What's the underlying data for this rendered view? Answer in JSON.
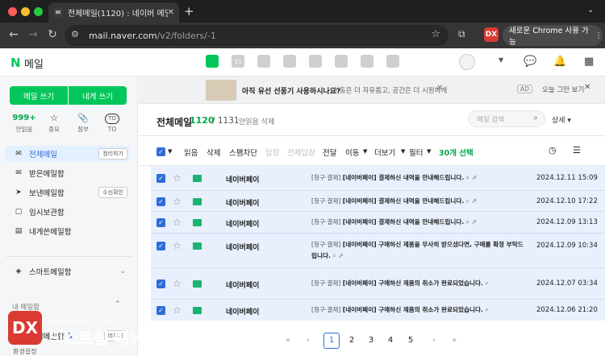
{
  "browser": {
    "tab_title": "전체메일(1120) : 네이버 메일",
    "tab_favicon": "mail-icon",
    "new_tab": "+",
    "url_host": "mail.naver.com",
    "url_path": "/v2/folders/-1",
    "translate_label": "새로운 Chrome 사용 가능",
    "extension_label": "DX"
  },
  "header": {
    "logo_n": "N",
    "logo_text": "메일",
    "app_icons": [
      "mail-app-icon",
      "calendar-app-icon",
      "contacts-app-icon",
      "memo-app-icon",
      "drive-app-icon",
      "todo-app-icon",
      "office-app-icon",
      "bookmark-app-icon"
    ],
    "calendar_day": "31"
  },
  "sidebar": {
    "write_button": "메일 쓰기",
    "self_button": "내게 쓰기",
    "quick": [
      {
        "value": "999+",
        "label": "안읽음"
      },
      {
        "glyph": "☆",
        "label": "중요"
      },
      {
        "glyph": "📎",
        "label": "첨부"
      },
      {
        "badge": "TO",
        "label": "TO"
      }
    ],
    "folders": [
      {
        "icon": "inbox-all-icon",
        "glyph": "✉",
        "label": "전체메일",
        "chip": "정리하기",
        "active": true
      },
      {
        "icon": "received-icon",
        "glyph": "✉",
        "label": "받은메일함"
      },
      {
        "icon": "sent-icon",
        "glyph": "➤",
        "label": "보낸메일함",
        "chip": "수신확인"
      },
      {
        "icon": "drafts-icon",
        "glyph": "▢",
        "label": "임시보관함"
      },
      {
        "icon": "self-icon",
        "glyph": "▤",
        "label": "내게쓴메일함"
      }
    ],
    "smart_folder": "스마트메일함",
    "my_folders": "내 메일함",
    "spam": {
      "label": "스팸메일함",
      "count": "3",
      "chip": "비우기"
    },
    "settings": "환경설정"
  },
  "watermark": {
    "logo": "DX",
    "small": "More Better IT Life",
    "big": "익스트림 매뉴얼"
  },
  "banner": {
    "title": "아직 유선 선풍기 사용하시나요?",
    "sub": "이동은 더 자유롭고, 공간은 더 시원하게",
    "ad": "AD",
    "dismiss": "오늘 그만 보기"
  },
  "list_header": {
    "title": "전체메일",
    "unread": "1120",
    "total": "/ 1131",
    "unread_delete": "안읽음 삭제",
    "search_placeholder": "메일 검색",
    "detail": "상세 ▾"
  },
  "toolbar": {
    "read": "읽음",
    "delete": "삭제",
    "spam": "스팸차단",
    "reply": "답장",
    "reply_all": "전체답장",
    "forward": "전달",
    "move": "이동",
    "more": "더보기",
    "filter": "필터",
    "selected": "30개 선택"
  },
  "mails": [
    {
      "sender": "네이버페이",
      "category": "[청구·결제]",
      "subject": "[네이버페이] 결제하신 내역을 안내해드립니다.",
      "date": "2024.12.11 15:09"
    },
    {
      "sender": "네이버페이",
      "category": "[청구·결제]",
      "subject": "[네이버페이] 결제하신 내역을 안내해드립니다.",
      "date": "2024.12.10 17:22"
    },
    {
      "sender": "네이버페이",
      "category": "[청구·결제]",
      "subject": "[네이버페이] 결제하신 내역을 안내해드립니다.",
      "date": "2024.12.09 13:13"
    },
    {
      "sender": "네이버페이",
      "category": "[청구·결제]",
      "subject": "[네이버페이] 구매하신 제품을 무사히 받으셨다면, 구매를 확정 부탁드립니다.",
      "date": "2024.12.09 10:34"
    },
    {
      "sender": "네이버페이",
      "category": "[청구·결제]",
      "subject": "[네이버페이] 구매하신 제품의 취소가 완료되었습니다.",
      "date": "2024.12.07 03:34"
    },
    {
      "sender": "네이버페이",
      "category": "[청구·결제]",
      "subject": "[네이버페이] 구매하신 제품의 취소가 완료되었습니다.",
      "date": "2024.12.06 21:20"
    }
  ],
  "pager": {
    "pages": [
      "1",
      "2",
      "3",
      "4",
      "5"
    ],
    "current": "1"
  },
  "colors": {
    "brand": "#03c75a",
    "selected_row": "#e8f0fe",
    "checkbox": "#2f6dd7"
  }
}
